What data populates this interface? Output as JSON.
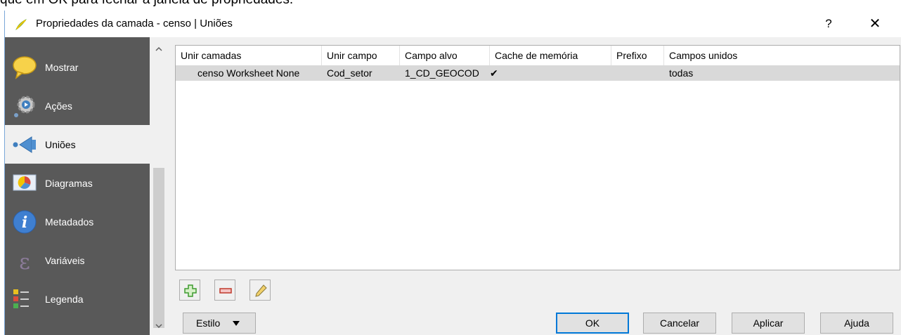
{
  "document_text": "que em OK para fechar a janela de propriedades.",
  "window": {
    "title": "Propriedades da camada - censo | Uniões",
    "help_label": "?",
    "close_label": "✕"
  },
  "sidebar": {
    "items": [
      {
        "label": "Mostrar",
        "icon": "speech-bubble-icon",
        "active": false
      },
      {
        "label": "Ações",
        "icon": "gear-icon",
        "active": false
      },
      {
        "label": "Uniões",
        "icon": "join-arrow-icon",
        "active": true
      },
      {
        "label": "Diagramas",
        "icon": "diagram-icon",
        "active": false
      },
      {
        "label": "Metadados",
        "icon": "info-icon",
        "active": false
      },
      {
        "label": "Variáveis",
        "icon": "epsilon-icon",
        "active": false
      },
      {
        "label": "Legenda",
        "icon": "legend-icon",
        "active": false
      }
    ]
  },
  "joins_table": {
    "columns": [
      "Unir camadas",
      "Unir campo",
      "Campo alvo",
      "Cache de memória",
      "Prefixo",
      "Campos unidos"
    ],
    "rows": [
      {
        "join_layer": "censo Worksheet None",
        "join_field": "Cod_setor",
        "target_field": "1_CD_GEOCOD",
        "memory_cache": "✔",
        "prefix": "",
        "joined_fields": "todas"
      }
    ]
  },
  "toolbar": {
    "add_icon": "add-join-icon",
    "remove_icon": "remove-join-icon",
    "edit_icon": "edit-pencil-icon"
  },
  "buttons": {
    "style": "Estilo",
    "ok": "OK",
    "cancel": "Cancelar",
    "apply": "Aplicar",
    "help": "Ajuda"
  },
  "colors": {
    "sidebar_bg": "#595959",
    "selected_row": "#d9d9d9",
    "default_button_border": "#0078d7"
  }
}
